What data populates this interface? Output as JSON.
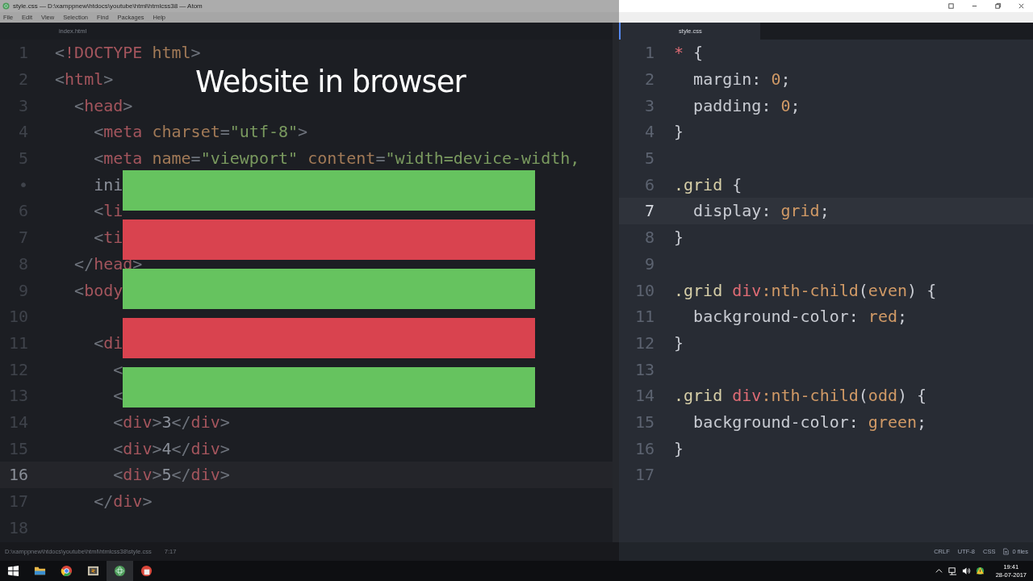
{
  "window": {
    "title": "style.css — D:\\xamppnew\\htdocs\\youtube\\html\\htmlcss38 — Atom"
  },
  "menu": [
    "File",
    "Edit",
    "View",
    "Selection",
    "Find",
    "Packages",
    "Help"
  ],
  "panes": [
    {
      "tab": {
        "label": "index.html",
        "selected": false
      },
      "kind": "html",
      "lines": [
        {
          "number": "1",
          "text": "<!DOCTYPE html>",
          "current": false
        },
        {
          "number": "2",
          "text": "<html>",
          "current": false
        },
        {
          "number": "3",
          "text": "  <head>",
          "current": false
        },
        {
          "number": "4",
          "text": "    <meta charset=\"utf-8\">",
          "current": false
        },
        {
          "number": "5",
          "text": "    <meta name=\"viewport\" content=\"width=device-width,",
          "current": false
        },
        {
          "number": "•",
          "text": "    ini",
          "current": false
        },
        {
          "number": "6",
          "text": "    <li",
          "current": false
        },
        {
          "number": "7",
          "text": "    <ti",
          "current": false
        },
        {
          "number": "8",
          "text": "  </head>",
          "current": false
        },
        {
          "number": "9",
          "text": "  <body",
          "current": false
        },
        {
          "number": "10",
          "current": false
        },
        {
          "number": "11",
          "text": "    <di",
          "current": false
        },
        {
          "number": "12",
          "text": "      <",
          "current": false
        },
        {
          "number": "13",
          "text": "      <",
          "current": false
        },
        {
          "number": "14",
          "text": "      <div>3</div>",
          "current": false
        },
        {
          "number": "15",
          "text": "      <div>4</div>",
          "current": false
        },
        {
          "number": "16",
          "text": "      <div>5</div>",
          "current": true
        },
        {
          "number": "17",
          "text": "    </div>",
          "current": false
        },
        {
          "number": "18",
          "current": false
        }
      ]
    },
    {
      "tab": {
        "label": "style.css",
        "selected": true
      },
      "kind": "css",
      "lines": [
        {
          "number": "1",
          "text": "* {",
          "current": false
        },
        {
          "number": "2",
          "text": "  margin: 0;",
          "current": false
        },
        {
          "number": "3",
          "text": "  padding: 0;",
          "current": false
        },
        {
          "number": "4",
          "text": "}",
          "current": false
        },
        {
          "number": "5",
          "current": false
        },
        {
          "number": "6",
          "text": ".grid {",
          "current": false
        },
        {
          "number": "7",
          "text": "  display: grid;",
          "current": true
        },
        {
          "number": "8",
          "text": "}",
          "current": false
        },
        {
          "number": "9",
          "current": false
        },
        {
          "number": "10",
          "text": ".grid div:nth-child(even) {",
          "current": false
        },
        {
          "number": "11",
          "text": "  background-color: red;",
          "current": false
        },
        {
          "number": "12",
          "text": "}",
          "current": false
        },
        {
          "number": "13",
          "current": false
        },
        {
          "number": "14",
          "text": ".grid div:nth-child(odd) {",
          "current": false
        },
        {
          "number": "15",
          "text": "  background-color: green;",
          "current": false
        },
        {
          "number": "16",
          "text": "}",
          "current": false
        },
        {
          "number": "17",
          "current": false
        }
      ]
    }
  ],
  "overlay": {
    "title": "Website in browser",
    "bars": [
      {
        "color": "#66c35f"
      },
      {
        "color": "#d9434f"
      },
      {
        "color": "#66c35f"
      },
      {
        "color": "#d9434f"
      },
      {
        "color": "#66c35f"
      }
    ]
  },
  "status_bar": {
    "path": "D:\\xamppnew\\htdocs\\youtube\\html\\htmlcss38\\style.css",
    "cursor": "7:17",
    "items": [
      "CRLF",
      "UTF-8",
      "CSS"
    ],
    "files": "0 files"
  },
  "taskbar": {
    "apps": [
      {
        "kind": "folder",
        "active": false
      },
      {
        "kind": "browser",
        "active": false
      },
      {
        "kind": "editor",
        "active": false
      },
      {
        "kind": "atom",
        "active": true
      },
      {
        "kind": "app",
        "active": false
      }
    ],
    "time": "19:41",
    "date": "28-07-2017"
  }
}
